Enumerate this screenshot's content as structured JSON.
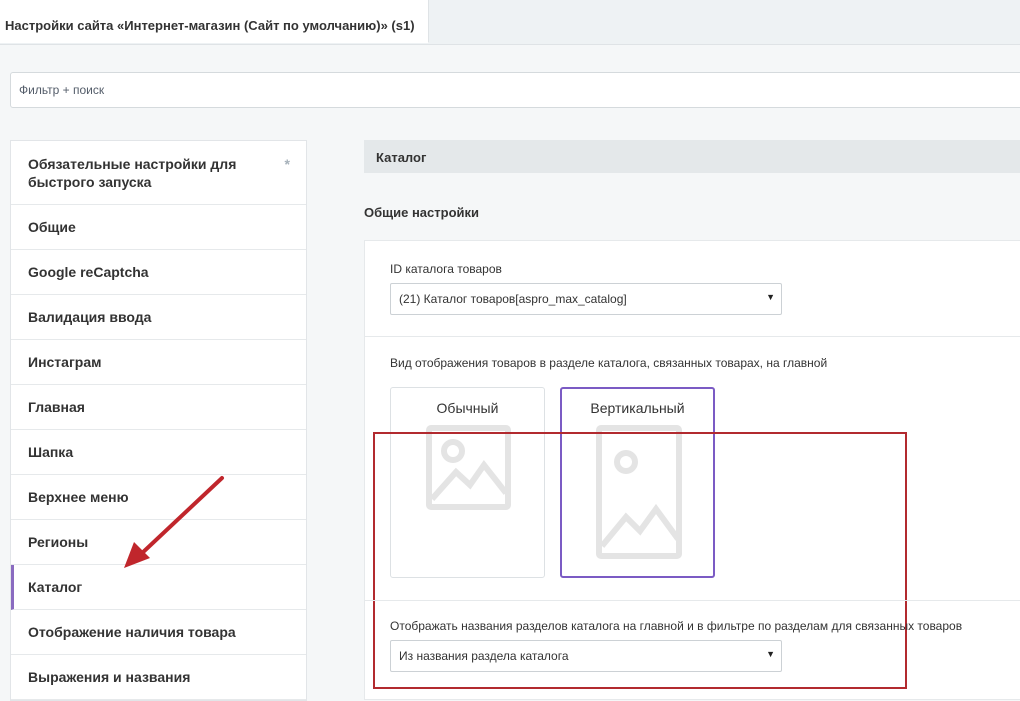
{
  "tabs": {
    "active": "Настройки сайта «Интернет-магазин (Сайт по умолчанию)» (s1)"
  },
  "filter": {
    "placeholder": "Фильтр + поиск"
  },
  "sidebar": {
    "items": [
      {
        "label": "Обязательные настройки для быстрого запуска",
        "icon": "star-icon"
      },
      {
        "label": "Общие"
      },
      {
        "label": "Google reCaptcha"
      },
      {
        "label": "Валидация ввода"
      },
      {
        "label": "Инстаграм"
      },
      {
        "label": "Главная"
      },
      {
        "label": "Шапка"
      },
      {
        "label": "Верхнее меню"
      },
      {
        "label": "Регионы"
      },
      {
        "label": "Каталог",
        "active": true
      },
      {
        "label": "Отображение наличия товара"
      },
      {
        "label": "Выражения и названия"
      }
    ],
    "star_glyph": "*"
  },
  "main": {
    "section_title": "Каталог",
    "subsection_title": "Общие настройки",
    "catalog_id": {
      "label": "ID каталога товаров",
      "value": "(21) Каталог товаров[aspro_max_catalog]"
    },
    "display_view": {
      "label": "Вид отображения товаров в разделе каталога, связанных товарах, на главной",
      "options": [
        {
          "label": "Обычный",
          "selected": false
        },
        {
          "label": "Вертикальный",
          "selected": true
        }
      ]
    },
    "section_names": {
      "label": "Отображать названия разделов каталога на главной и в фильтре по разделам для связанных товаров",
      "value": "Из названия раздела каталога"
    },
    "select_arrow": "▼"
  },
  "colors": {
    "highlight_border": "#b22a2f",
    "selected_card_border": "#7b5bc4",
    "annotation_arrow": "#c0262c"
  }
}
